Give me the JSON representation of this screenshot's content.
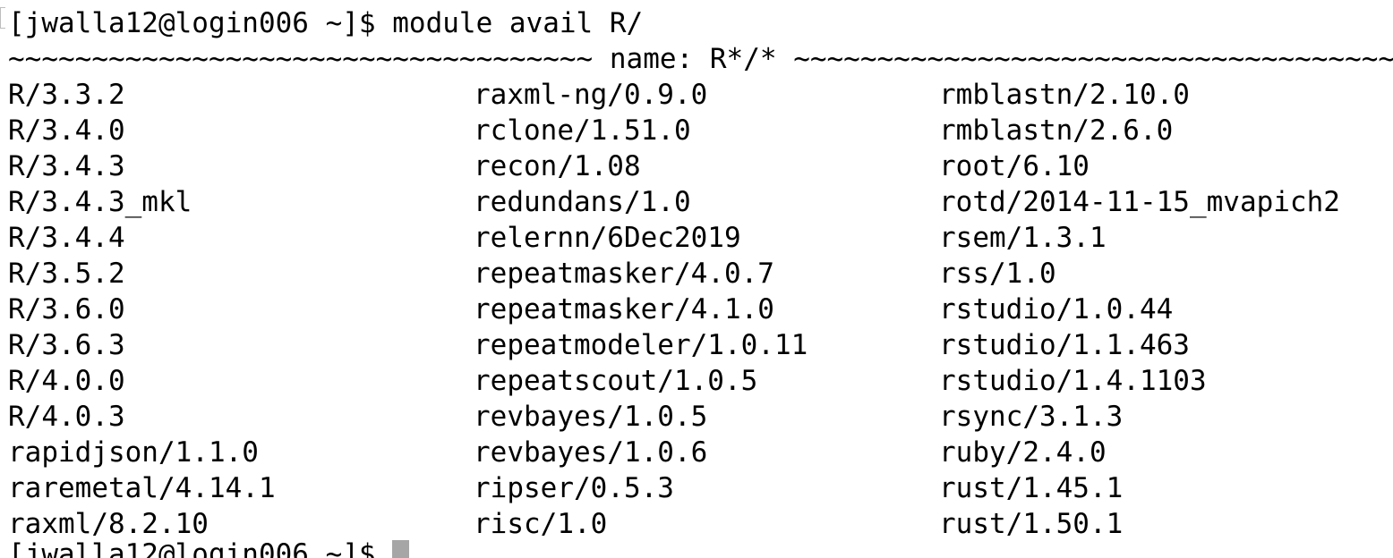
{
  "terminal": {
    "command_line": "[jwalla12@login006 ~]$ module avail R/",
    "header_line": "~~~~~~~~~~~~~~~~~~~~~~~~~~~~~~~~~~~ name: R*/* ~~~~~~~~~~~~~~~~~~~~~~~~~~~~~~~~~~~~",
    "columns": [
      [
        "R/3.3.2",
        "R/3.4.0",
        "R/3.4.3",
        "R/3.4.3_mkl",
        "R/3.4.4",
        "R/3.5.2",
        "R/3.6.0",
        "R/3.6.3",
        "R/4.0.0",
        "R/4.0.3",
        "rapidjson/1.1.0",
        "raremetal/4.14.1",
        "raxml/8.2.10"
      ],
      [
        "raxml-ng/0.9.0",
        "rclone/1.51.0",
        "recon/1.08",
        "redundans/1.0",
        "relernn/6Dec2019",
        "repeatmasker/4.0.7",
        "repeatmasker/4.1.0",
        "repeatmodeler/1.0.11",
        "repeatscout/1.0.5",
        "revbayes/1.0.5",
        "revbayes/1.0.6",
        "ripser/0.5.3",
        "risc/1.0"
      ],
      [
        "rmblastn/2.10.0",
        "rmblastn/2.6.0",
        "root/6.10",
        "rotd/2014-11-15_mvapich2",
        "rsem/1.3.1",
        "rss/1.0",
        "rstudio/1.0.44",
        "rstudio/1.1.463",
        "rstudio/1.4.1103",
        "rsync/3.1.3",
        "ruby/2.4.0",
        "rust/1.45.1",
        "rust/1.50.1"
      ]
    ],
    "prompt": "[jwalla12@login006 ~]$ ",
    "colors": {
      "background": "#ffffff",
      "text": "#000000",
      "cursor": "#a6a6a6"
    }
  }
}
